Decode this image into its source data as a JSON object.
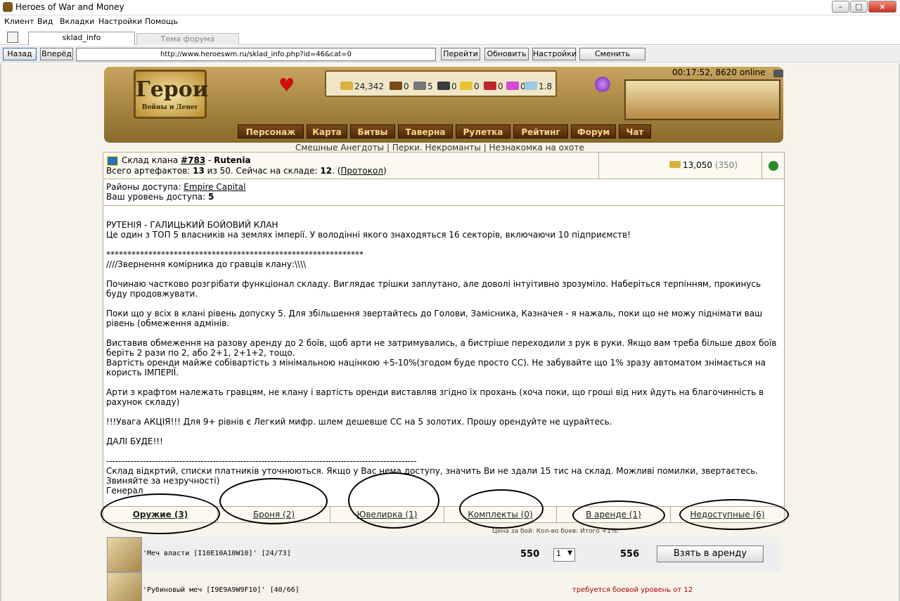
{
  "window": {
    "title": "Heroes of War and Money"
  },
  "menu": [
    "Клиент",
    "Вид",
    "Вкладки",
    "Настройки",
    "Помощь"
  ],
  "tabs": [
    {
      "label": "sklad_info"
    },
    {
      "label": "Тема форума"
    }
  ],
  "nav": {
    "back": "Назад",
    "forward": "Вперёд",
    "url": "http://www.heroeswm.ru/sklad_info.php?id=46&cat=0",
    "go": "Перейти",
    "refresh": "Обновить",
    "settings": "Настройки",
    "switch_player": "Сменить игрока"
  },
  "game": {
    "logo_line1": "Герои",
    "logo_line2": "Войны и Денег",
    "resources": [
      "24,342",
      "0",
      "5",
      "0",
      "0",
      "0",
      "0",
      "1.8"
    ],
    "online": "00:17:52, 8620 online",
    "main_nav": [
      "Персонаж",
      "Карта",
      "Битвы",
      "Таверна",
      "Рулетка",
      "Рейтинг",
      "Форум",
      "Чат"
    ],
    "sublinks": [
      "Смешные Анегдоты",
      "Перки. Некроманты",
      "Незнакомка на охоте"
    ]
  },
  "warehouse": {
    "clan_prefix": "Склад клана ",
    "clan_id": "#783",
    "clan_sep": " - ",
    "clan_name": "Rutenia",
    "art_prefix": "Всего артефактов: ",
    "art_total": "13",
    "art_mid": " из 50. Сейчас на складе: ",
    "art_now": "12",
    "art_tail": ". (",
    "protocol": "Протокол",
    "art_close": ")",
    "gold": "13,050",
    "gold_extra": "(350)",
    "access_prefix": "Районы доступа: ",
    "access_region": "Empire Capital",
    "level_prefix": "Ваш уровень доступа: ",
    "level": "5"
  },
  "description": [
    "РУТЕНІЯ - ГАЛИЦЬКИЙ БОЙОВИЙ КЛАН",
    "Це один з ТОП 5 власників на землях імперії. У володінні якого знаходяться 16 секторів, включаючи 10 підприємств!",
    "*************************************************************",
    "////Звернення комірника до гравців клану:\\\\\\\\",
    "Починаю частково розгрібати функціонал складу. Виглядає трішки заплутано, але доволі інтуітивно зрозуміло. Наберіться терпінням, прокинусь буду продовжувати.",
    "Поки що у всіх в клані рівень допуску 5. Для збільшення звертайтесь до Голови, Замісника, Казначея - я нажаль, поки що не можу піднімати ваш рівень (обмеження адмінів.",
    "Виставив обмеження на разову аренду до 2 боїв, щоб арти не затримувались, а бистріше переходили з рук в руки. Якщо вам треба більше двох боїв беріть 2 рази по 2, або 2+1, 2+1+2, тощо.",
    "Вартість оренди майже собівартість з мінімальною націнкою +5-10%(згодом буде просто СС). Не забувайте що 1% зразу автоматом знімається на користь ІМПЕРІЇ.",
    "Арти з крафтом належать гравцям, не клану і вартість оренди виставляв згідно їх прохань (хоча поки, що гроші від них йдуть на благочинність в рахунок складу)",
    "!!!Увага АКЦІЯ!!! Для 9+ рівнів є Легкий мифр. шлем дешевше СС на 5 золотих. Прошу орендуйте не цурайтесь.",
    "ДАЛІ БУДЕ!!!",
    "------------------------------------------------------------------------------------------------------",
    "Склад відкртий, списки платників уточнюються. Якщо у Вас нема доступу, значить Ви не здали 15 тис на склад. Можливі помилки, звертаєтесь. Звиняйте за незручності)",
    "Генерал"
  ],
  "categories": [
    "Оружие (3)",
    "Броня (2)",
    "Ювелирка (1)",
    "Комплекты (0)",
    "В аренде (1)",
    "Недоступные (6)"
  ],
  "table_header": "Цена за бой: Кол-во боев: Итого +1%:",
  "items": [
    {
      "name": "'Меч власти [I10E10A10W10]' [24/73]",
      "price": "550",
      "qty": "1",
      "total": "556",
      "action": "Взять в аренду"
    },
    {
      "name": "'Рубиновый меч [I9E9A9W9F10]' [40/66]",
      "requirement": "требуется боевой уровень от 12"
    }
  ],
  "colors": {
    "gold": "#d8b23b",
    "nav_brown": "#5e3410",
    "requirement": "#b00000"
  }
}
